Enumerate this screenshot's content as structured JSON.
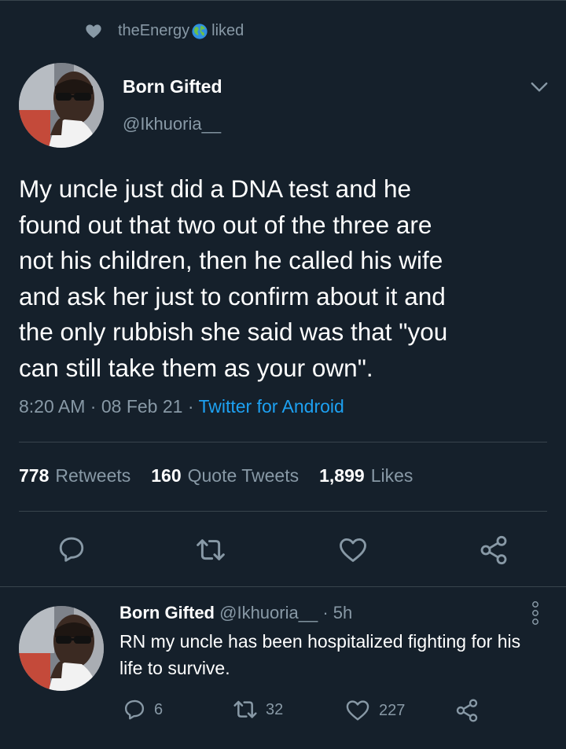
{
  "social_context": {
    "user": "theEnergy",
    "action": "liked"
  },
  "tweet": {
    "author_name": "Born Gifted",
    "author_handle": "@Ikhuoria__",
    "text": "My uncle just did a DNA test and he\nfound out that two out of the three  are\nnot his children, then he called his wife\nand ask her just to confirm about it and\nthe only rubbish she said was that \"you\ncan still take them as your own\".",
    "time": "8:20 AM",
    "date": "08 Feb 21",
    "source": "Twitter for Android",
    "stats": {
      "retweets_count": "778",
      "retweets_label": "Retweets",
      "quotes_count": "160",
      "quotes_label": "Quote Tweets",
      "likes_count": "1,899",
      "likes_label": "Likes"
    }
  },
  "reply": {
    "author_name": "Born Gifted",
    "author_handle": "@Ikhuoria__",
    "age": "5h",
    "text": "RN my uncle has been hospitalized fighting for his life to survive.",
    "reply_count": "6",
    "retweet_count": "32",
    "like_count": "227"
  },
  "icons": {
    "social_context": "heart-icon",
    "globe": "globe-icon",
    "menu": "chevron-down-icon",
    "reply": "reply-icon",
    "retweet": "retweet-icon",
    "like": "heart-outline-icon",
    "share": "share-icon",
    "more": "more-vertical-icon"
  },
  "colors": {
    "background": "#15202b",
    "secondary_text": "#8899a6",
    "accent": "#1da1f2",
    "divider": "#38444d"
  }
}
